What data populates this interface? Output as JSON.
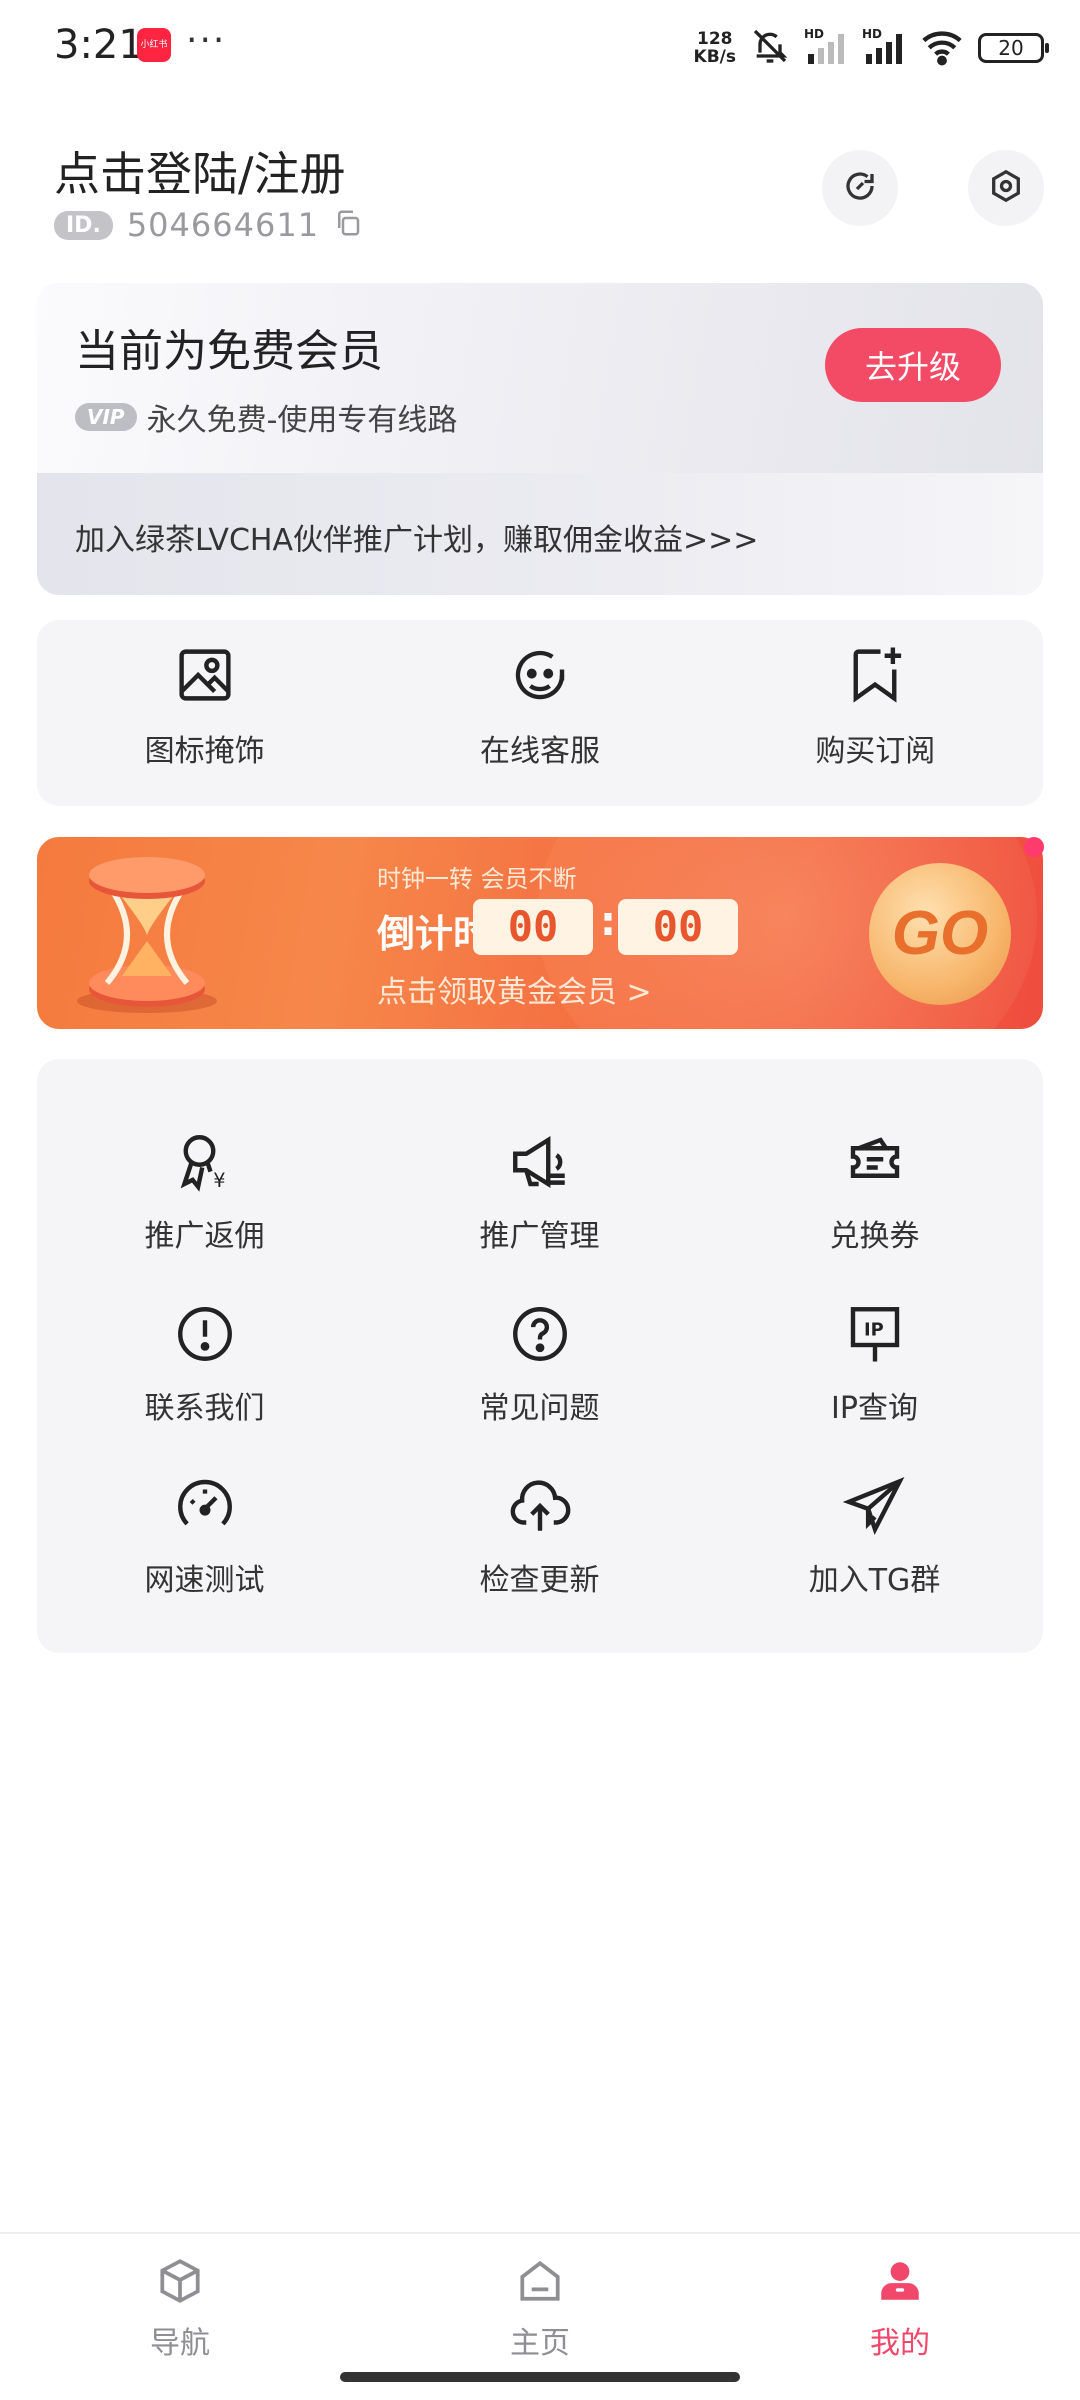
{
  "status_bar": {
    "time": "3:21",
    "notif_app": "小红书",
    "dots": "···",
    "net_speed_value": "128",
    "net_speed_unit": "KB/s",
    "battery": "20"
  },
  "header": {
    "login_title": "点击登陆/注册",
    "id_badge": "ID.",
    "id_value": "504664611"
  },
  "member_card": {
    "title": "当前为免费会员",
    "vip_badge": "VIP",
    "vip_text": "永久免费-使用专有线路",
    "upgrade_label": "去升级",
    "promo_text": "加入绿茶LVCHA伙伴推广计划，赚取佣金收益>>>"
  },
  "quick_actions": [
    {
      "label": "图标掩饰",
      "icon": "image-icon"
    },
    {
      "label": "在线客服",
      "icon": "customer-service-icon"
    },
    {
      "label": "购买订阅",
      "icon": "bookmark-plus-icon"
    }
  ],
  "banner": {
    "subtitle": "时钟一转 会员不断",
    "countdown_label": "倒计时",
    "countdown_minutes": "00",
    "countdown_seconds": "00",
    "countdown_sep": ":",
    "claim_text": "点击领取黄金会员 >",
    "go_label": "GO"
  },
  "grid": [
    {
      "label": "推广返佣",
      "icon": "award-yuan-icon"
    },
    {
      "label": "推广管理",
      "icon": "megaphone-icon"
    },
    {
      "label": "兑换券",
      "icon": "coupon-icon"
    },
    {
      "label": "联系我们",
      "icon": "exclamation-icon"
    },
    {
      "label": "常见问题",
      "icon": "question-icon"
    },
    {
      "label": "IP查询",
      "icon": "ip-icon"
    },
    {
      "label": "网速测试",
      "icon": "speedometer-icon"
    },
    {
      "label": "检查更新",
      "icon": "cloud-upload-icon"
    },
    {
      "label": "加入TG群",
      "icon": "telegram-icon"
    }
  ],
  "bottom_nav": [
    {
      "label": "导航",
      "icon": "cube-icon",
      "active": false
    },
    {
      "label": "主页",
      "icon": "home-icon",
      "active": false
    },
    {
      "label": "我的",
      "icon": "user-icon",
      "active": true
    }
  ],
  "colors": {
    "accent": "#f34b66",
    "nav_active": "#f0476a",
    "nav_inactive": "#8e8e93"
  }
}
